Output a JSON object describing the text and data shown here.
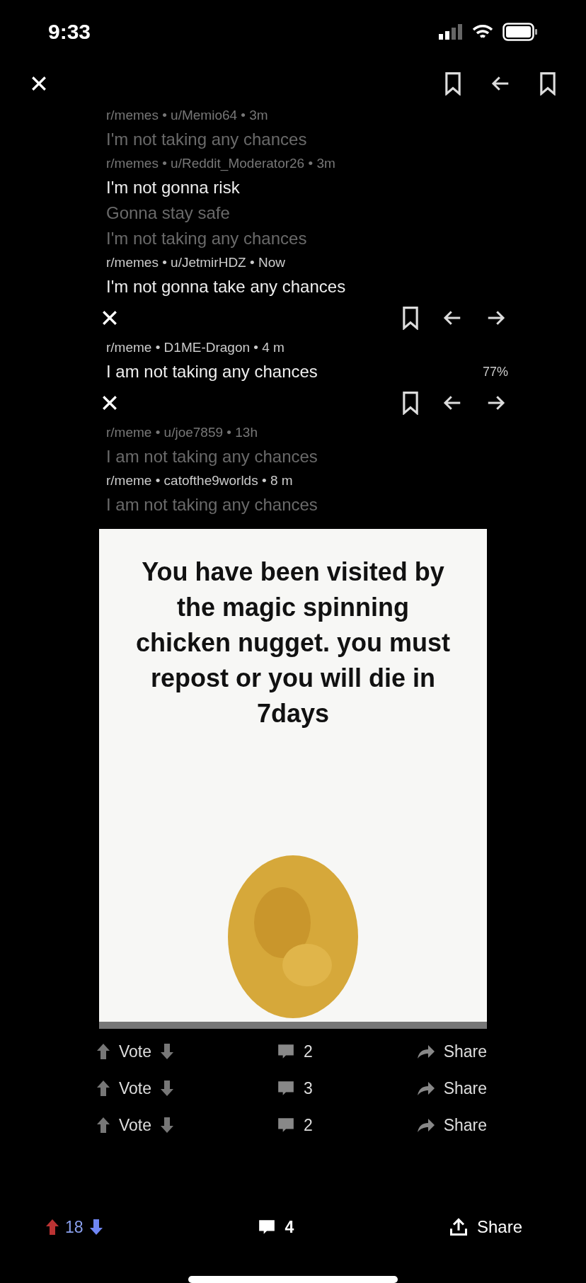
{
  "status_bar": {
    "time": "9:33"
  },
  "stack": [
    {
      "kind": "meta",
      "text": "r/memes • u/Memio64 • 3m",
      "faded": true
    },
    {
      "kind": "title",
      "text": "I'm not taking any chances",
      "faded": true
    },
    {
      "kind": "meta",
      "text": "r/memes • u/Reddit_Moderator26 • 3m",
      "faded": true
    },
    {
      "kind": "title",
      "text": "I'm not gonna risk",
      "faded": false
    },
    {
      "kind": "title",
      "text": "Gonna stay safe",
      "faded": true
    },
    {
      "kind": "title",
      "text": "I'm not taking any chances",
      "faded": true
    },
    {
      "kind": "meta",
      "text": "r/memes • u/JetmirHDZ • Now",
      "faded": false
    },
    {
      "kind": "title",
      "text": "I'm not gonna take any chances",
      "faded": false
    },
    {
      "kind": "toolbar"
    },
    {
      "kind": "meta",
      "text": "r/meme • D1ME-Dragon • 4 m",
      "faded": false
    },
    {
      "kind": "title",
      "text": "I am not taking any chances",
      "faded": false,
      "battery": "77%"
    },
    {
      "kind": "toolbar"
    },
    {
      "kind": "meta",
      "text": "r/meme • u/joe7859 • 13h",
      "faded": true
    },
    {
      "kind": "title",
      "text": "I am not taking any chances",
      "faded": true
    },
    {
      "kind": "meta",
      "text": "r/meme • catofthe9worlds • 8 m",
      "faded": false
    },
    {
      "kind": "title",
      "text": "I am not taking any chances",
      "faded": true
    }
  ],
  "post": {
    "caption": "You have been visited by the magic spinning chicken nugget. you must repost or you will die in 7days"
  },
  "action_rows": [
    {
      "vote": "Vote",
      "comments": "2",
      "share": "Share"
    },
    {
      "vote": "Vote",
      "comments": "3",
      "share": "Share"
    },
    {
      "vote": "Vote",
      "comments": "2",
      "share": "Share"
    }
  ],
  "bottom_bar": {
    "score": "18",
    "downvoted": true,
    "comments": "4",
    "share": "Share"
  }
}
